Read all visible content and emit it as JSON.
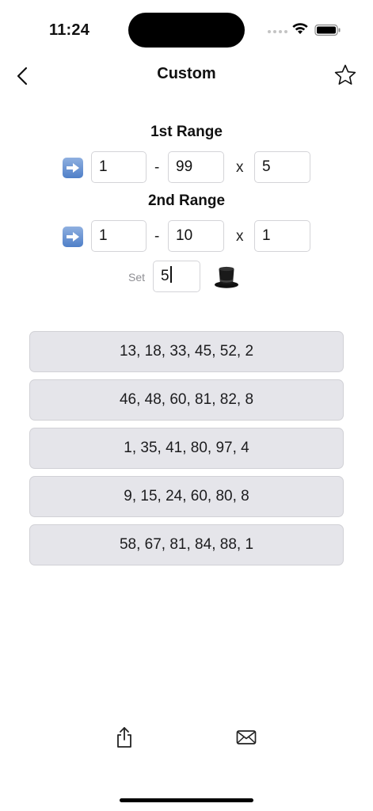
{
  "status_bar": {
    "time": "11:24"
  },
  "nav": {
    "title": "Custom",
    "back_icon": "chevron-left-icon",
    "favorite_icon": "star-outline-icon"
  },
  "range1": {
    "title": "1st Range",
    "from": "1",
    "dash": "-",
    "to": "99",
    "times": "x",
    "count": "5"
  },
  "range2": {
    "title": "2nd Range",
    "from": "1",
    "dash": "-",
    "to": "10",
    "times": "x",
    "count": "1"
  },
  "set": {
    "label": "Set",
    "value": "5",
    "generate_icon": "top-hat-icon"
  },
  "results": [
    "13, 18, 33, 45, 52, 2",
    "46, 48, 60, 81, 82, 8",
    "1, 35, 41, 80, 97, 4",
    "9, 15, 24, 60, 80, 8",
    "58, 67, 81, 84, 88, 1"
  ],
  "toolbar": {
    "share_icon": "share-icon",
    "mail_icon": "mail-icon"
  },
  "colors": {
    "result_bg": "#e5e5ea",
    "arrow_badge": "#4f7fc8",
    "placeholder_gray": "#8e8e93"
  }
}
